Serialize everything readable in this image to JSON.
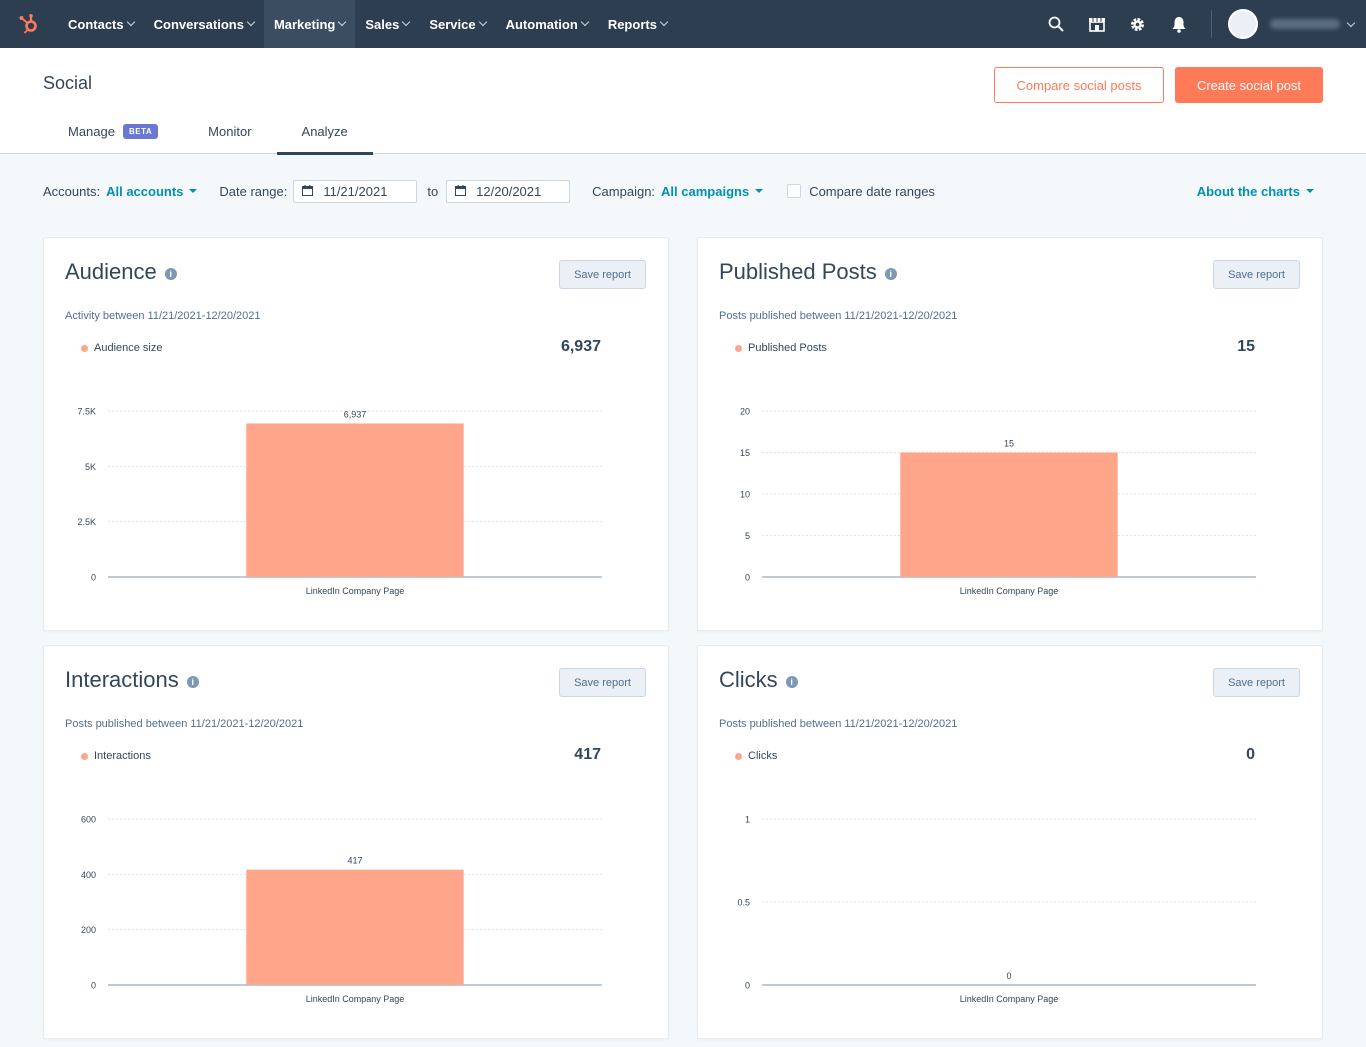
{
  "nav": {
    "items": [
      {
        "label": "Contacts",
        "active": false
      },
      {
        "label": "Conversations",
        "active": false
      },
      {
        "label": "Marketing",
        "active": true
      },
      {
        "label": "Sales",
        "active": false
      },
      {
        "label": "Service",
        "active": false
      },
      {
        "label": "Automation",
        "active": false
      },
      {
        "label": "Reports",
        "active": false
      }
    ],
    "icons": [
      "search-icon",
      "marketplace-icon",
      "settings-icon",
      "notifications-icon"
    ]
  },
  "header": {
    "title": "Social",
    "compare_button": "Compare social posts",
    "create_button": "Create social post",
    "tabs": [
      {
        "label": "Manage",
        "badge": "BETA",
        "active": false
      },
      {
        "label": "Monitor",
        "active": false
      },
      {
        "label": "Analyze",
        "active": true
      }
    ]
  },
  "filters": {
    "accounts_label": "Accounts:",
    "accounts_value": "All accounts",
    "date_range_label": "Date range:",
    "date_from": "11/21/2021",
    "to_label": "to",
    "date_to": "12/20/2021",
    "campaign_label": "Campaign:",
    "campaign_value": "All campaigns",
    "compare_label": "Compare date ranges",
    "compare_checked": false,
    "about_label": "About the charts"
  },
  "colors": {
    "bar": "#ffa58a",
    "accent": "#ff7a59",
    "link": "#0091ae"
  },
  "cards": [
    {
      "title": "Audience",
      "save_label": "Save report",
      "subtitle": "Activity between 11/21/2021-12/20/2021",
      "legend": "Audience size",
      "total": "6,937",
      "chart_data": {
        "type": "bar",
        "categories": [
          "LinkedIn Company Page"
        ],
        "values": [
          6937
        ],
        "value_labels": [
          "6,937"
        ],
        "yticks": [
          0,
          2500,
          5000,
          7500
        ],
        "ytick_labels": [
          "0",
          "2.5K",
          "5K",
          "7.5K"
        ],
        "ylim": [
          0,
          7500
        ]
      }
    },
    {
      "title": "Published Posts",
      "save_label": "Save report",
      "subtitle": "Posts published between 11/21/2021-12/20/2021",
      "legend": "Published Posts",
      "total": "15",
      "chart_data": {
        "type": "bar",
        "categories": [
          "LinkedIn Company Page"
        ],
        "values": [
          15
        ],
        "value_labels": [
          "15"
        ],
        "yticks": [
          0,
          5,
          10,
          15,
          20
        ],
        "ytick_labels": [
          "0",
          "5",
          "10",
          "15",
          "20"
        ],
        "ylim": [
          0,
          20
        ]
      }
    },
    {
      "title": "Interactions",
      "save_label": "Save report",
      "subtitle": "Posts published between 11/21/2021-12/20/2021",
      "legend": "Interactions",
      "total": "417",
      "chart_data": {
        "type": "bar",
        "categories": [
          "LinkedIn Company Page"
        ],
        "values": [
          417
        ],
        "value_labels": [
          "417"
        ],
        "yticks": [
          0,
          200,
          400,
          600
        ],
        "ytick_labels": [
          "0",
          "200",
          "400",
          "600"
        ],
        "ylim": [
          0,
          600
        ]
      }
    },
    {
      "title": "Clicks",
      "save_label": "Save report",
      "subtitle": "Posts published between 11/21/2021-12/20/2021",
      "legend": "Clicks",
      "total": "0",
      "chart_data": {
        "type": "bar",
        "categories": [
          "LinkedIn Company Page"
        ],
        "values": [
          0
        ],
        "value_labels": [
          "0"
        ],
        "yticks": [
          0,
          0.5,
          1
        ],
        "ytick_labels": [
          "0",
          "0.5",
          "1"
        ],
        "ylim": [
          0,
          1
        ]
      }
    }
  ]
}
